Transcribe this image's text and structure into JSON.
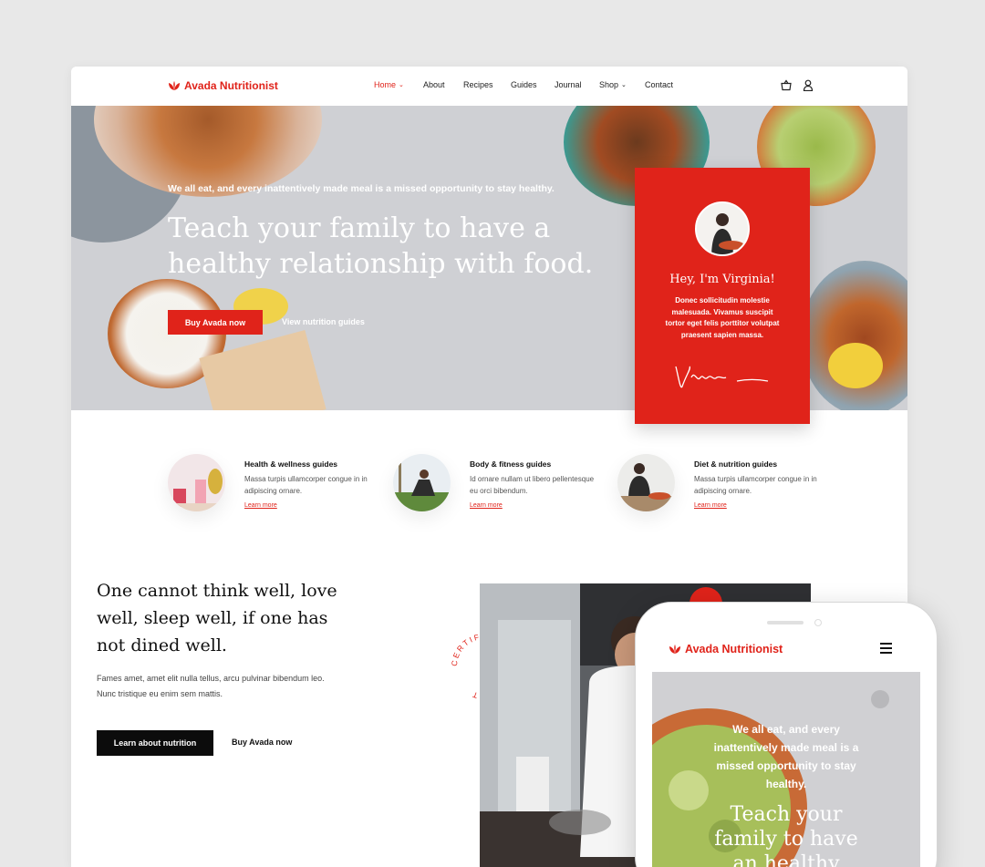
{
  "brand": {
    "name": "Avada Nutritionist",
    "accent": "#e0231a"
  },
  "nav": [
    {
      "label": "Home",
      "active": true,
      "has_dropdown": true
    },
    {
      "label": "About"
    },
    {
      "label": "Recipes"
    },
    {
      "label": "Guides"
    },
    {
      "label": "Journal"
    },
    {
      "label": "Shop",
      "has_dropdown": true
    },
    {
      "label": "Contact"
    }
  ],
  "header_icons": [
    "cart-icon",
    "user-icon"
  ],
  "hero": {
    "pretitle": "We all eat, and every inattentively made meal is a missed opportunity to stay healthy.",
    "title": "Teach your family to have a healthy relationship with food.",
    "primary_button": "Buy Avada now",
    "secondary_link": "View nutrition guides"
  },
  "profile_card": {
    "title": "Hey, I'm Virginia!",
    "text": "Donec sollicitudin molestie malesuada. Vivamus suscipit tortor eget felis porttitor volutpat praesent sapien massa."
  },
  "features": [
    {
      "title": "Health & wellness guides",
      "text": "Massa turpis ullamcorper congue in in adipiscing ornare.",
      "link": "Learn more"
    },
    {
      "title": "Body & fitness guides",
      "text": "Id ornare nullam ut libero pellentesque eu orci bibendum.",
      "link": "Learn more"
    },
    {
      "title": "Diet & nutrition guides",
      "text": "Massa turpis ullamcorper congue in in adipiscing ornare.",
      "link": "Learn more"
    }
  ],
  "about": {
    "quote": "One cannot think well, love well, sleep well, if one has not dined well.",
    "text": "Fames amet, amet elit nulla tellus, arcu pulvinar bibendum leo. Nunc tristique eu enim sem mattis.",
    "primary_button": "Learn about nutrition",
    "secondary_link": "Buy Avada now",
    "badge_text": "CERTIFIED NUTRITIONIST"
  },
  "mobile": {
    "brand": "Avada Nutritionist",
    "pretitle": "We all eat, and every inattentively made meal is a missed opportunity to stay healthy.",
    "title": "Teach your family to have an healthy"
  }
}
